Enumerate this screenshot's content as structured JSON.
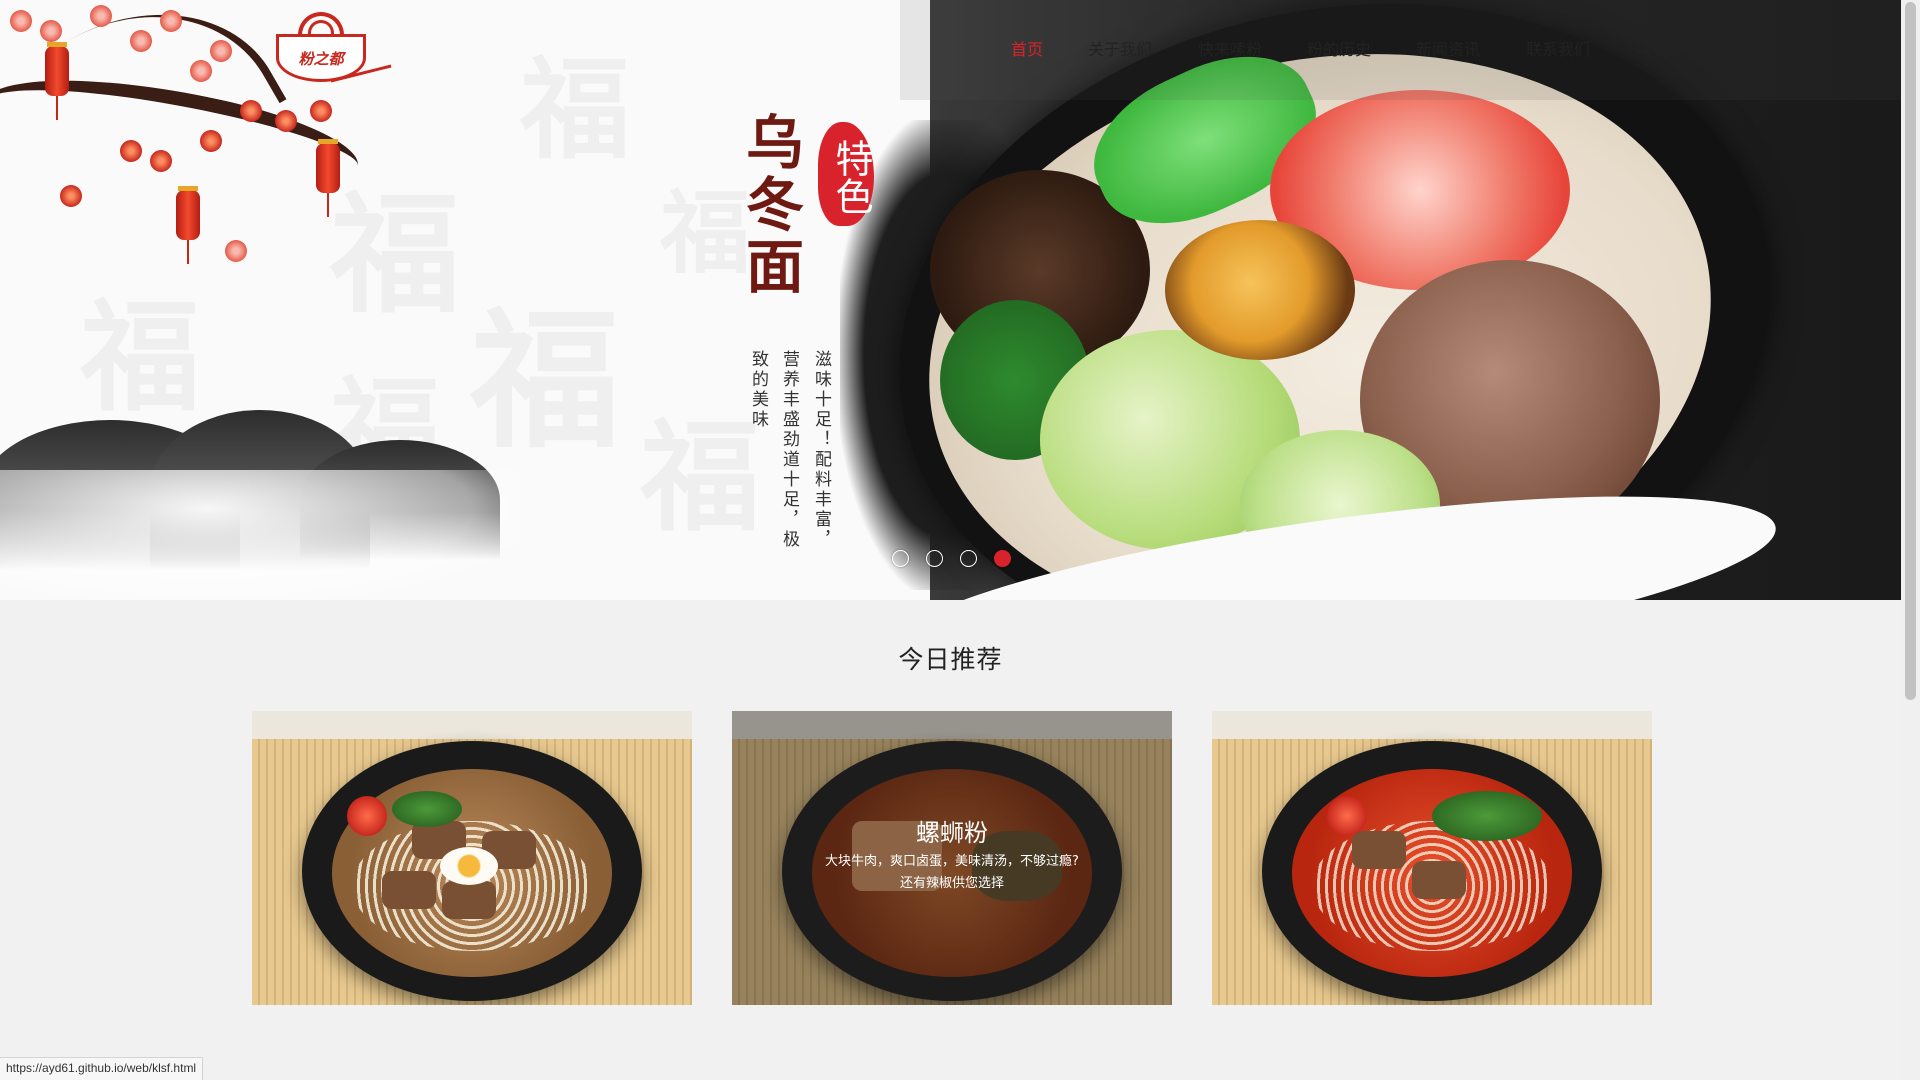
{
  "brand": {
    "logo_text": "粉之都"
  },
  "nav": {
    "items": [
      {
        "label": "首页",
        "active": true
      },
      {
        "label": "关于我们",
        "active": false
      },
      {
        "label": "快来嗦粉",
        "active": false
      },
      {
        "label": "粉的历史",
        "active": false
      },
      {
        "label": "新闻资讯",
        "active": false
      },
      {
        "label": "联系我们",
        "active": false
      }
    ],
    "search_icon": "search-icon",
    "active_color": "#d9232c"
  },
  "hero": {
    "title": "乌冬面",
    "seal": "特色",
    "desc_col1": "滋味十足！配料丰富，",
    "desc_col2": "营养丰盛劲道十足，极",
    "desc_col3": "致的美味",
    "slides_total": 4,
    "slide_active": 4
  },
  "section": {
    "title": "今日推荐",
    "cards": [
      {
        "title": "",
        "desc": ""
      },
      {
        "title": "螺蛳粉",
        "desc_line1": "大块牛肉，爽口卤蛋，美味清汤，不够过瘾?",
        "desc_line2": "还有辣椒供您选择"
      },
      {
        "title": "",
        "desc": ""
      }
    ]
  },
  "status_bar": {
    "url": "https://ayd61.github.io/web/klsf.html"
  }
}
